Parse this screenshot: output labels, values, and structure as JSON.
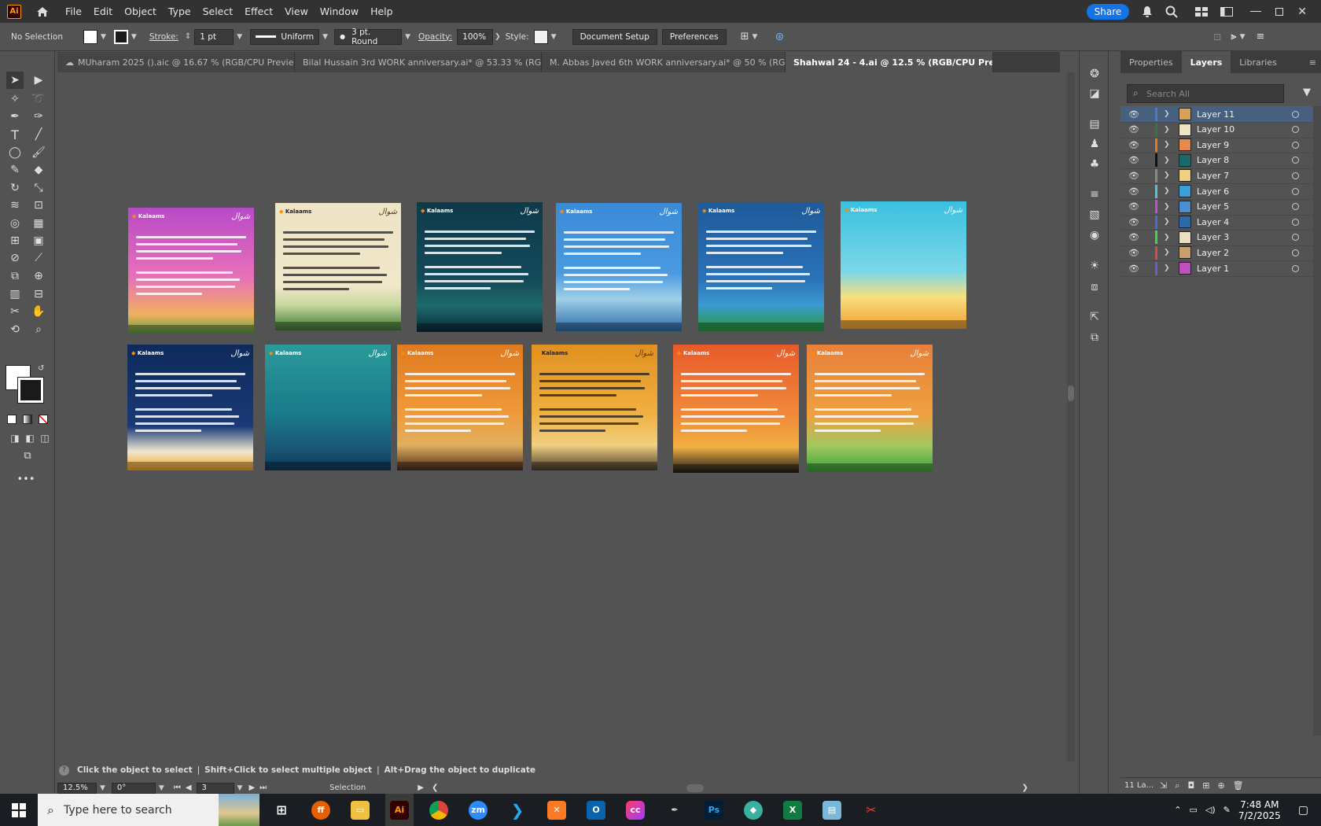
{
  "app": {
    "logo": "Ai",
    "home_icon": "home-icon"
  },
  "menu": [
    "File",
    "Edit",
    "Object",
    "Type",
    "Select",
    "Effect",
    "View",
    "Window",
    "Help"
  ],
  "header_right": {
    "share": "Share"
  },
  "control": {
    "selection": "No Selection",
    "stroke_label": "Stroke:",
    "stroke_value": "1 pt",
    "stroke_profile": "Uniform",
    "brush": "3 pt. Round",
    "opacity_label": "Opacity:",
    "opacity_value": "100%",
    "style_label": "Style:",
    "doc_setup": "Document Setup",
    "preferences": "Preferences"
  },
  "tabs": [
    {
      "label": "MUharam 2025 ().aic @ 16.67 % (RGB/CPU Previe..."
    },
    {
      "label": "Bilal Hussain  3rd  WORK anniversary.ai* @ 53.33 % (RG..."
    },
    {
      "label": "M. Abbas Javed  6th  WORK anniversary.ai* @ 50 % (RG..."
    },
    {
      "label": "Shahwal 24 - 4.ai @ 12.5 % (RGB/CPU Preview)",
      "active": true
    }
  ],
  "panel": {
    "tabs": [
      "Properties",
      "Layers",
      "Libraries"
    ],
    "search_placeholder": "Search All",
    "footer": "11 La..."
  },
  "layers": [
    {
      "name": "Layer 11",
      "color": "#4a7ac8",
      "thumb": "#d9a25a",
      "selected": true
    },
    {
      "name": "Layer 10",
      "color": "#2d7a3a",
      "thumb": "#ece4c4"
    },
    {
      "name": "Layer 9",
      "color": "#e07a1f",
      "thumb": "#e48a4a"
    },
    {
      "name": "Layer 8",
      "color": "#111111",
      "thumb": "#1a6a6a"
    },
    {
      "name": "Layer 7",
      "color": "#888888",
      "thumb": "#f0d080"
    },
    {
      "name": "Layer 6",
      "color": "#4ec8d8",
      "thumb": "#3aa0d8"
    },
    {
      "name": "Layer 5",
      "color": "#c84ad8",
      "thumb": "#4a90d0"
    },
    {
      "name": "Layer 4",
      "color": "#4a6ad8",
      "thumb": "#2a6aa8"
    },
    {
      "name": "Layer 3",
      "color": "#3ad84a",
      "thumb": "#e8e0c0"
    },
    {
      "name": "Layer 2",
      "color": "#d84a4a",
      "thumb": "#c8a070"
    },
    {
      "name": "Layer 1",
      "color": "#6a5ad8",
      "thumb": "#c050c0"
    }
  ],
  "status": {
    "hint_1": "Click the object to select",
    "hint_2": "Shift+Click to select multiple object",
    "hint_3": "Alt+Drag the object to duplicate",
    "zoom": "12.5%",
    "rotation": "0°",
    "artboard_num": "3",
    "tool": "Selection"
  },
  "artboard_text": {
    "logo": "Kalaams",
    "mark": "شوال"
  },
  "artboards": [
    {
      "bg": "linear-gradient(#b84ac8,#e870b8 55%,#f0b060 85%,#5aa040)",
      "dark": false
    },
    {
      "bg": "linear-gradient(#ece4c4,#f0e8c8 65%,#c8d8a0 80%,#3a7a30)",
      "dark": true
    },
    {
      "bg": "linear-gradient(#0e3a4a,#134a5a 60%,#1e6a6a 80%,#0a2a3a)",
      "dark": false
    },
    {
      "bg": "linear-gradient(#3a8ad8,#4a9ae0 55%,#a0d0e8 75%,#2a6aa8)",
      "dark": false
    },
    {
      "bg": "linear-gradient(#1e5a9a,#2a72b8 60%,#3a9ad0 80%,#2a9a3a)",
      "dark": false
    },
    {
      "bg": "linear-gradient(#3ac0e0,#7ad8e8 55%,#f8e080 75%,#f0a030)",
      "dark": false
    },
    {
      "bg": "linear-gradient(#0e2a5a,#1a3a78 65%,#f0e8d0 85%,#f0a020)",
      "dark": false
    },
    {
      "bg": "linear-gradient(#2a9a9a,#1a7a8a 55%,#1a5a7a 80%,#0e3a5a)",
      "dark": false
    },
    {
      "bg": "linear-gradient(#e07a1f,#f09a3a 55%,#e0b060 80%,#4a2a1a)",
      "dark": false
    },
    {
      "bg": "linear-gradient(#e0901f,#f0b040 55%,#f0d080 80%,#4a3a2a)",
      "dark": true
    },
    {
      "bg": "linear-gradient(#e85a2a,#f08a3a 55%,#f0b040 80%,#1a1a1a)",
      "dark": false
    },
    {
      "bg": "linear-gradient(#e8803a,#f0a040 55%,#a0c860 80%,#3aa03a)",
      "dark": false
    }
  ],
  "taskbar": {
    "search": "Type here to search",
    "time": "7:48 AM",
    "date": "7/2/2025"
  }
}
